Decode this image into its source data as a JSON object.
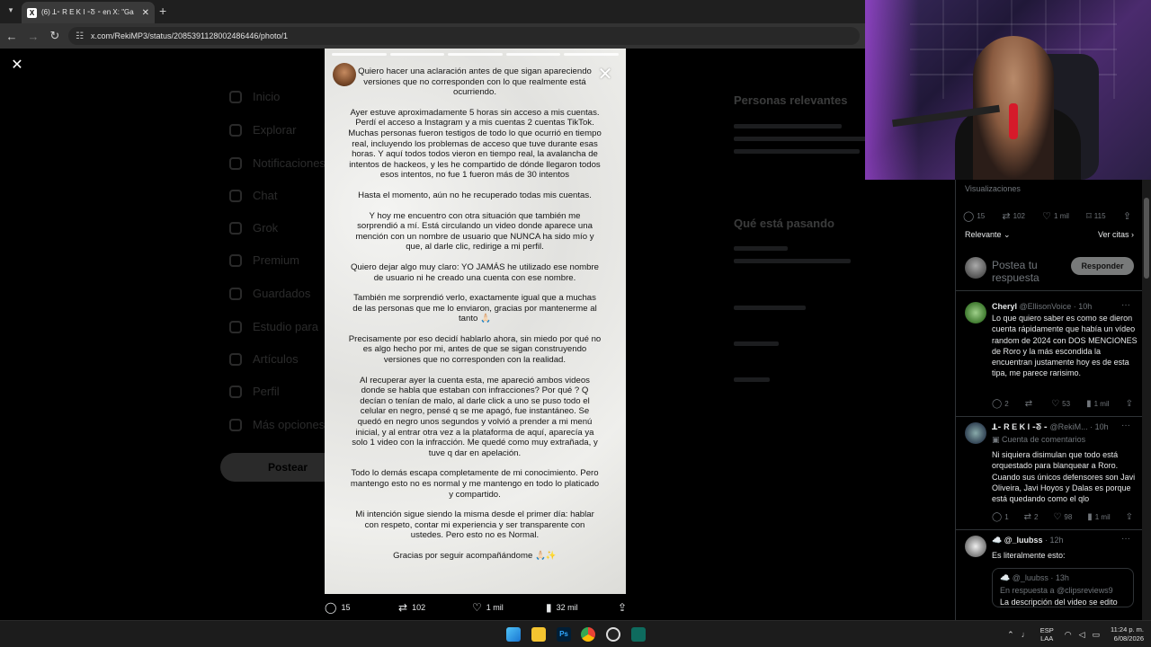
{
  "browser": {
    "tab_title": "(6) ꓕ⁃ R E K I ⁃ᘕ ⁃ en X: \"Ga",
    "url": "x.com/RekiMP3/status/2085391128002486446/photo/1"
  },
  "background_nav": {
    "items": [
      "Inicio",
      "Explorar",
      "Notificaciones",
      "Chat",
      "Grok",
      "Premium",
      "Guardados",
      "Estudio para",
      "Artículos",
      "Perfil",
      "Más opciones"
    ],
    "post_button": "Postear",
    "relevant_people_heading": "Personas relevantes",
    "trending_heading": "Qué está pasando"
  },
  "story": {
    "paragraphs": [
      "Quiero hacer una aclaración antes de que sigan apareciendo versiones que no corresponden con lo que realmente está ocurriendo.",
      "Ayer estuve aproximadamente 5 horas sin acceso a mis cuentas. Perdí el acceso a Instagram y a mis cuentas 2 cuentas TikTok. Muchas personas fueron testigos de todo lo que ocurrió en tiempo real, incluyendo los problemas de acceso que tuve durante esas horas. Y aquí todos todos vieron en tiempo real, la avalancha de intentos de hackeos, y les he compartido de dónde llegaron todos esos intentos, no fue 1 fueron más de 30 intentos",
      "Hasta el momento, aún no he recuperado todas mis cuentas.",
      "Y hoy me encuentro con otra situación que también me sorprendió a mí. Está circulando un video donde aparece una mención con un nombre de usuario que NUNCA ha sido mío y que, al darle clic, redirige a mi perfil.",
      "Quiero dejar algo muy claro: YO JAMÁS he utilizado ese nombre de usuario ni he creado una cuenta con ese nombre.",
      "También me sorprendió verlo, exactamente igual que a muchas de las personas que me lo enviaron, gracias por mantenerme al tanto 🙏🏻",
      "Precisamente por eso decidí hablarlo ahora, sin miedo por qué no es algo hecho por mi, antes de que se sigan construyendo versiones que no corresponden con la realidad.",
      "Al recuperar ayer la cuenta esta, me apareció ambos videos donde se habla que estaban con infracciones? Por qué ? Q decían o tenían de malo, al darle click a uno se puso todo el celular en negro, pensé q se me apagó, fue instantáneo. Se quedó en negro unos segundos y volvió a prender a mi menú inicial, y al entrar otra vez a la plataforma de aquí, aparecía ya solo 1 video con la infracción. Me quedé como muy extrañada, y tuve q dar en apelación.",
      "Todo lo demás escapa completamente de mi conocimiento. Pero mantengo esto no es normal y me mantengo en todo lo platicado y compartido.",
      "Mi intención sigue siendo la misma desde el primer día: hablar con respeto, contar mi experiencia y ser transparente con ustedes. Pero esto no es Normal.",
      "Gracias por seguir acompañándome 🙏🏻✨"
    ]
  },
  "viewer_actions": {
    "replies": "15",
    "reposts": "102",
    "likes": "1 mil",
    "views": "32 mil"
  },
  "right_panel": {
    "views_label": "Visualizaciones",
    "stats": {
      "replies": "15",
      "reposts": "102",
      "likes": "1 mil",
      "bookmarks": "115"
    },
    "sort_label": "Relevante",
    "see_quotes": "Ver citas",
    "reply_placeholder": "Postea tu respuesta",
    "reply_button": "Responder",
    "comments": [
      {
        "name": "Cheryl",
        "handle": "@EllisonVoice · 10h",
        "body": "Lo que quiero saber es como se dieron cuenta rápidamente que había un vídeo random de 2024 con DOS MENCIONES de Roro y la más escondida la encuentran justamente hoy es de esta tipa, me parece rarisimo.",
        "replies": "2",
        "reposts": "",
        "likes": "53",
        "views": "1 mil"
      },
      {
        "name": "ꓕ⁃ R E K I ⁃ᘕ ⁃",
        "handle": "@RekiM... · 10h",
        "sub": "Cuenta de comentarios",
        "body": "Ni siquiera disimulan que todo está orquestado para  blanquear a Roro. Cuando sus únicos defensores son Javi Oliveira, Javi Hoyos y Dalas es porque está quedando como el qlo",
        "replies": "1",
        "reposts": "2",
        "likes": "98",
        "views": "1 mil"
      },
      {
        "name": "☁️ @_luubss",
        "handle": "· 12h",
        "body": "Es literalmente esto:",
        "quote_name": "☁️ @_luubss · 13h",
        "quote_reply": "En respuesta a @clipsreviews9",
        "quote_body": "La descripción del video se edito"
      }
    ]
  },
  "taskbar": {
    "lang_top": "ESP",
    "lang_bottom": "LAA",
    "time": "11:24 p. m.",
    "date": "6/08/2026"
  },
  "colors": {
    "accent_reply_button": "#787a7a",
    "muted_text": "#71767b",
    "divider": "#2f3336"
  }
}
